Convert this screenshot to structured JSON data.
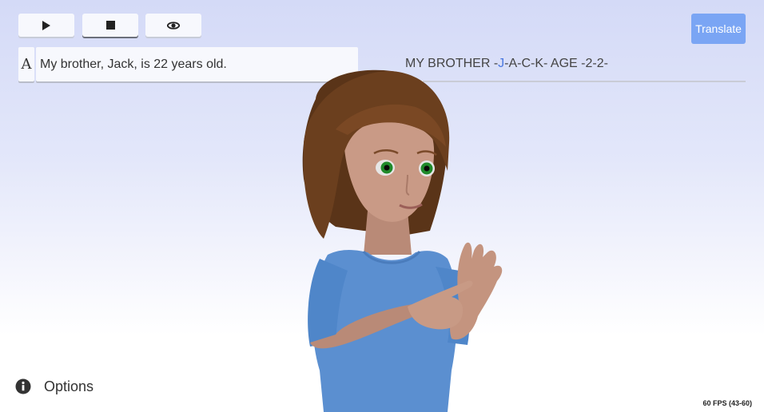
{
  "toolbar": {
    "play_icon": "play-icon",
    "stop_icon": "stop-icon",
    "view_icon": "eye-icon"
  },
  "input": {
    "font_button_label": "A",
    "sentence": "My brother, Jack, is 22 years old."
  },
  "gloss": {
    "prefix": "MY BROTHER -",
    "active_letter": "J",
    "suffix": "-A-C-K- AGE -2-2-"
  },
  "translate": {
    "label": "Translate"
  },
  "options": {
    "label": "Options",
    "icon": "info-icon"
  },
  "status": {
    "fps": "60 FPS (43-60)"
  },
  "colors": {
    "accent": "#7aa5f4",
    "active_gloss": "#4a78e0",
    "background_top": "#d4daf7",
    "avatar_shirt": "#5b8fd0",
    "avatar_hair": "#6b3f1e",
    "avatar_eyes": "#1f8a2a"
  }
}
